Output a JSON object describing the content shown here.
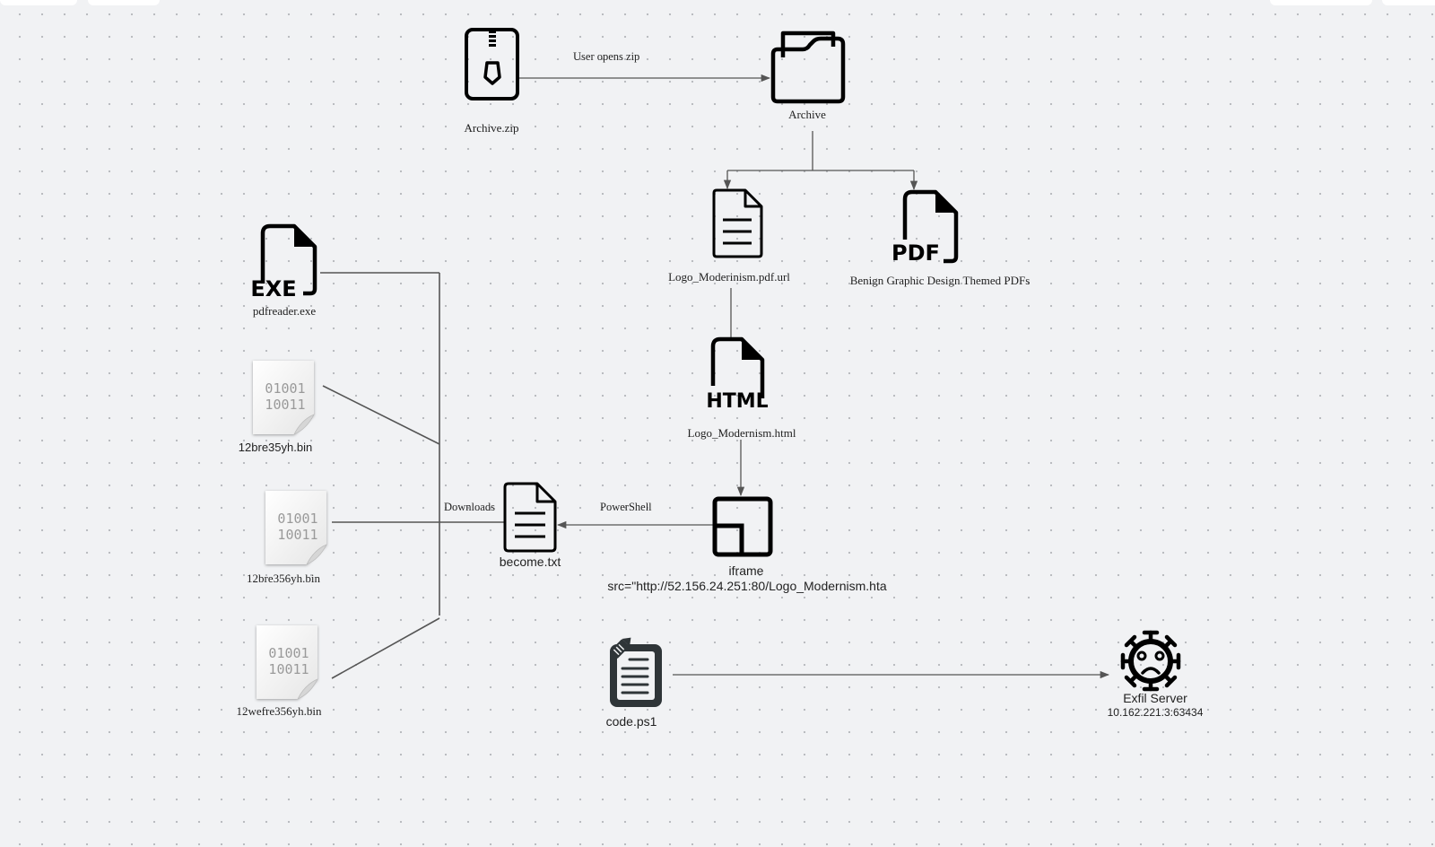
{
  "diagram": {
    "nodes": {
      "archive_zip": {
        "label": "Archive.zip",
        "icon": "zip-file-icon"
      },
      "archive": {
        "label": "Archive",
        "icon": "folder-icon"
      },
      "pdf_url": {
        "label": "Logo_Moderinism.pdf.url",
        "icon": "document-icon"
      },
      "benign_pdfs": {
        "label": "Benign Graphic Design Themed PDFs",
        "icon": "pdf-file-icon",
        "icon_text": "PDF"
      },
      "html": {
        "label": "Logo_Modernism.html",
        "icon": "html-file-icon",
        "icon_text": "HTML"
      },
      "iframe": {
        "label": "iframe",
        "sublabel": "src=\"http://52.156.24.251:80/Logo_Modernism.hta",
        "icon": "iframe-icon"
      },
      "become_txt": {
        "label": "become.txt",
        "icon": "document-icon"
      },
      "pdfreader": {
        "label": "pdfreader.exe",
        "icon": "exe-file-icon",
        "icon_text": "EXE"
      },
      "bin1": {
        "label": "12bre35yh.bin",
        "icon": "binary-file-icon",
        "icon_text": [
          "01001",
          "10011"
        ]
      },
      "bin2": {
        "label": "12bre356yh.bin",
        "icon": "binary-file-icon",
        "icon_text": [
          "01001",
          "10011"
        ]
      },
      "bin3": {
        "label": "12wefre356yh.bin",
        "icon": "binary-file-icon",
        "icon_text": [
          "01001",
          "10011"
        ]
      },
      "code_ps1": {
        "label": "code.ps1",
        "icon": "script-file-icon"
      },
      "exfil": {
        "label": "Exfil Server",
        "sublabel": "10.162.221.3:63434",
        "icon": "virus-icon"
      }
    },
    "edges": {
      "opens_zip": {
        "label": "User opens zip",
        "from": "Archive.zip",
        "to": "Archive"
      },
      "archive_split": {
        "from": "Archive",
        "to": [
          "Logo_Moderinism.pdf.url",
          "Benign Graphic Design Themed PDFs"
        ]
      },
      "url_to_html": {
        "from": "Logo_Moderinism.pdf.url",
        "to": "Logo_Modernism.html"
      },
      "html_to_iframe": {
        "from": "Logo_Modernism.html",
        "to": "iframe"
      },
      "powershell": {
        "label": "PowerShell",
        "from": "iframe",
        "to": "become.txt"
      },
      "downloads": {
        "label": "Downloads",
        "from": "become.txt",
        "to": [
          "pdfreader.exe",
          "12bre35yh.bin",
          "12bre356yh.bin",
          "12wefre356yh.bin"
        ]
      },
      "exfil": {
        "from": "code.ps1",
        "to": "Exfil Server"
      }
    }
  },
  "colors": {
    "background": "#f1f2f4",
    "icon": "#000000",
    "edge": "#555555",
    "binary_icon": "#9a9a9a"
  }
}
